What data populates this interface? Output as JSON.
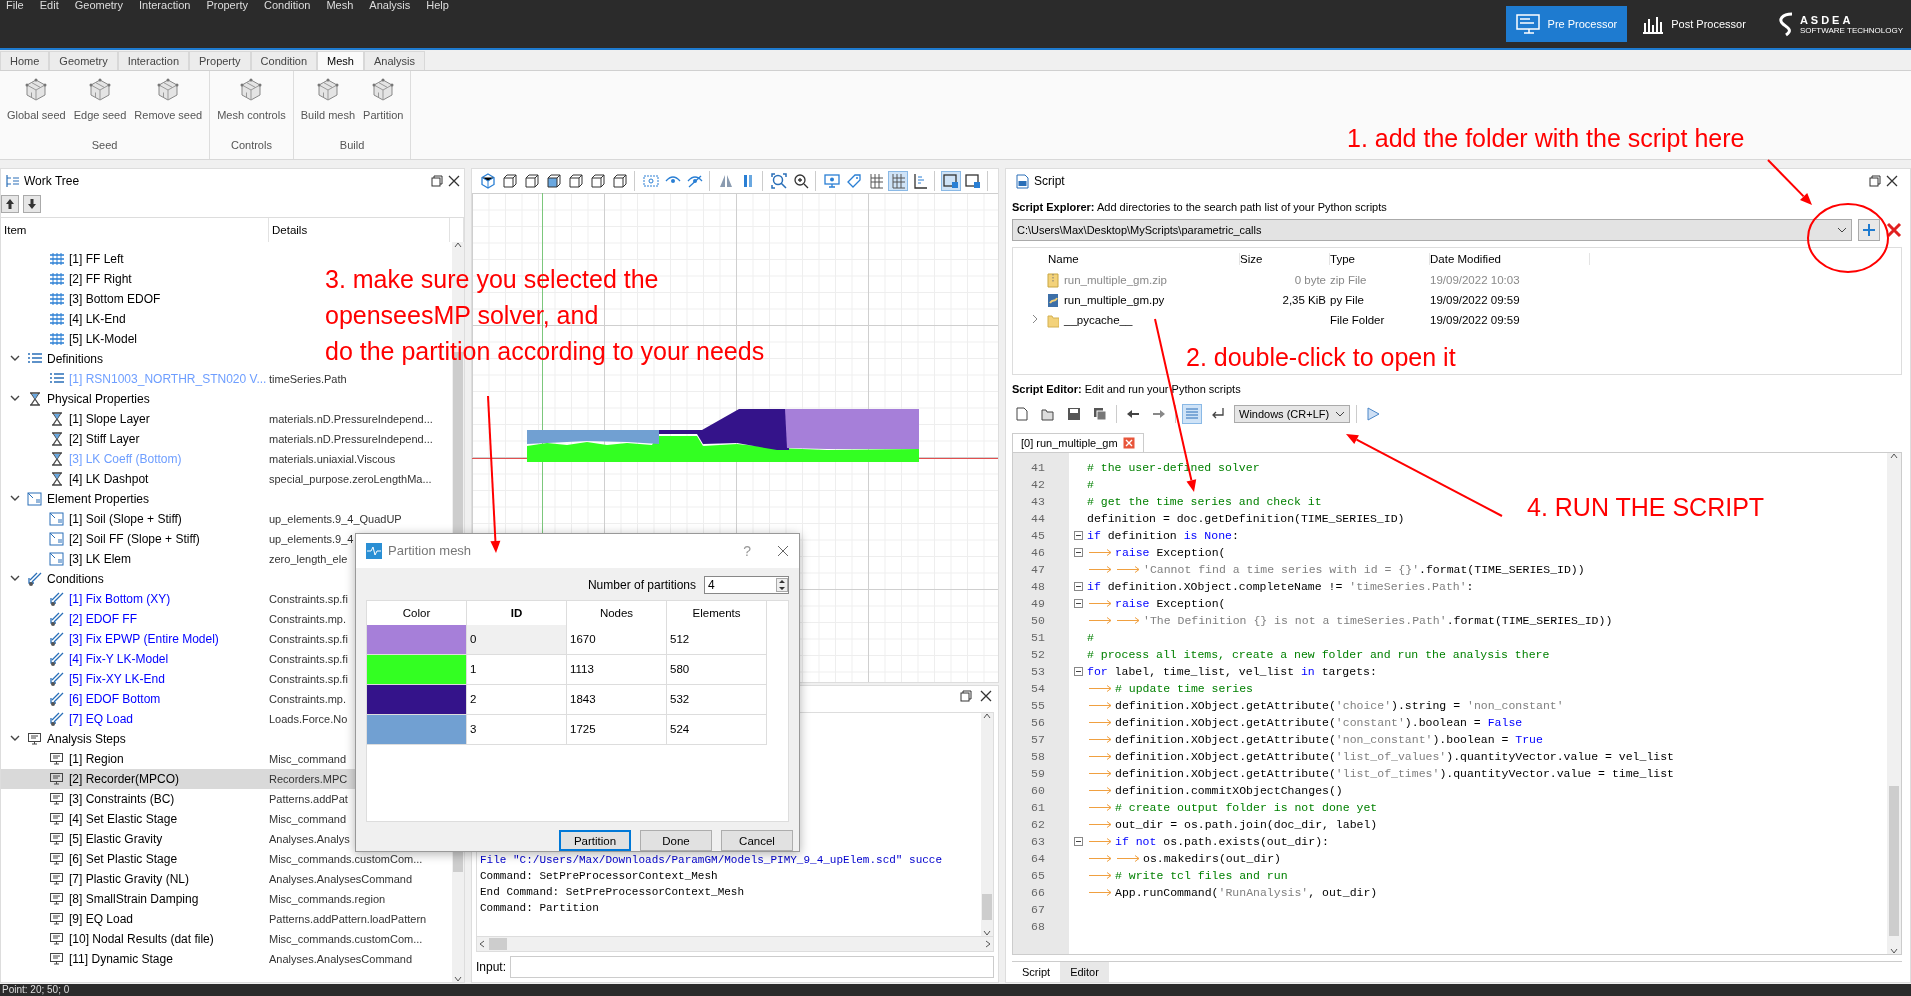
{
  "menu": [
    "File",
    "Edit",
    "Geometry",
    "Interaction",
    "Property",
    "Condition",
    "Mesh",
    "Analysis",
    "Help"
  ],
  "modes": [
    {
      "label": "Pre Processor",
      "selected": true
    },
    {
      "label": "Post Processor",
      "selected": false
    }
  ],
  "logo": {
    "name": "ASDEA",
    "tagline": "SOFTWARE TECHNOLOGY"
  },
  "ribbon_tabs": [
    {
      "label": "Home",
      "selected": false
    },
    {
      "label": "Geometry",
      "selected": false
    },
    {
      "label": "Interaction",
      "selected": false
    },
    {
      "label": "Property",
      "selected": false
    },
    {
      "label": "Condition",
      "selected": false
    },
    {
      "label": "Mesh",
      "selected": true
    },
    {
      "label": "Analysis",
      "selected": false
    }
  ],
  "ribbon_groups": [
    {
      "label": "Seed",
      "buttons": [
        "Global seed",
        "Edge seed",
        "Remove seed"
      ]
    },
    {
      "label": "Controls",
      "buttons": [
        "Mesh controls"
      ]
    },
    {
      "label": "Build",
      "buttons": [
        "Build mesh",
        "Partition"
      ]
    }
  ],
  "work_tree": {
    "title": "Work Tree",
    "columns": [
      "Item",
      "Details"
    ],
    "items": [
      {
        "children": [
          {
            "label": "[1] FF Left",
            "kind": "rails",
            "color": "#000000",
            "selected": false
          },
          {
            "label": "[2] FF Right",
            "kind": "rails",
            "color": "#000000",
            "selected": false
          },
          {
            "label": "[3] Bottom EDOF",
            "kind": "rails",
            "color": "#000000",
            "selected": false
          },
          {
            "label": "[4] LK-End",
            "kind": "rails",
            "color": "#000000",
            "selected": false
          },
          {
            "label": "[5] LK-Model",
            "kind": "rails",
            "color": "#000000",
            "selected": false
          }
        ]
      },
      {
        "label": "Definitions",
        "kind": "list",
        "expanded": true,
        "selected": false,
        "children": [
          {
            "label": "[1] RSN1003_NORTHR_STN020 V...",
            "details": "timeSeries.Path",
            "kind": "list",
            "color": "#6e9eff",
            "selected": false
          }
        ]
      },
      {
        "label": "Physical Properties",
        "kind": "hourglass",
        "expanded": true,
        "selected": false,
        "children": [
          {
            "label": "[1] Slope Layer",
            "details": "materials.nD.PressureIndepend...",
            "kind": "hourglass",
            "color": "#000000",
            "selected": false
          },
          {
            "label": "[2] Stiff Layer",
            "details": "materials.nD.PressureIndepend...",
            "kind": "hourglass",
            "color": "#000000",
            "selected": false
          },
          {
            "label": "[3] LK Coeff (Bottom)",
            "details": "materials.uniaxial.Viscous",
            "kind": "hourglass",
            "color": "#6e9eff",
            "selected": false
          },
          {
            "label": "[4] LK Dashpot",
            "details": "special_purpose.zeroLengthMa...",
            "kind": "hourglass",
            "color": "#000000",
            "selected": false
          }
        ]
      },
      {
        "label": "Element Properties",
        "kind": "element",
        "expanded": true,
        "selected": false,
        "children": [
          {
            "label": "[1] Soil (Slope + Stiff)",
            "details": "up_elements.9_4_QuadUP",
            "kind": "element",
            "color": "#000000",
            "selected": false
          },
          {
            "label": "[2] Soil FF (Slope + Stiff)",
            "details": "up_elements.9_4",
            "kind": "element",
            "color": "#000000",
            "selected": false
          },
          {
            "label": "[3] LK Elem",
            "details": "zero_length_ele",
            "kind": "element",
            "color": "#000000",
            "selected": false
          }
        ]
      },
      {
        "label": "Conditions",
        "kind": "arrows",
        "expanded": true,
        "selected": false,
        "children": [
          {
            "label": "[1] Fix Bottom (XY)",
            "details": "Constraints.sp.fi",
            "kind": "arrows",
            "color": "#0000ff",
            "selected": false
          },
          {
            "label": "[2] EDOF FF",
            "details": "Constraints.mp.",
            "kind": "arrows",
            "color": "#0000ff",
            "selected": false
          },
          {
            "label": "[3] Fix EPWP (Entire Model)",
            "details": "Constraints.sp.fi",
            "kind": "arrows",
            "color": "#0000ff",
            "selected": false
          },
          {
            "label": "[4] Fix-Y LK-Model",
            "details": "Constraints.sp.fi",
            "kind": "arrows",
            "color": "#0000ff",
            "selected": false
          },
          {
            "label": "[5] Fix-XY LK-End",
            "details": "Constraints.sp.fi",
            "kind": "arrows",
            "color": "#0000ff",
            "selected": false
          },
          {
            "label": "[6] EDOF Bottom",
            "details": "Constraints.mp.",
            "kind": "arrows",
            "color": "#0000ff",
            "selected": false
          },
          {
            "label": "[7] EQ Load",
            "details": "Loads.Force.No",
            "kind": "arrows",
            "color": "#0000ff",
            "selected": false
          }
        ]
      },
      {
        "label": "Analysis Steps",
        "kind": "monitor",
        "expanded": true,
        "selected": false,
        "children": [
          {
            "label": "[1] Region",
            "details": "Misc_command",
            "kind": "monitor",
            "color": "#000000",
            "selected": false
          },
          {
            "label": "[2] Recorder(MPCO)",
            "details": "Recorders.MPC",
            "kind": "monitor",
            "color": "#000000",
            "selected": true
          },
          {
            "label": "[3] Constraints (BC)",
            "details": "Patterns.addPat",
            "kind": "monitor",
            "color": "#000000",
            "selected": false
          },
          {
            "label": "[4] Set Elastic Stage",
            "details": "Misc_command",
            "kind": "monitor",
            "color": "#000000",
            "selected": false
          },
          {
            "label": "[5] Elastic Gravity",
            "details": "Analyses.Analys",
            "kind": "monitor",
            "color": "#000000",
            "selected": false
          },
          {
            "label": "[6] Set Plastic Stage",
            "details": "Misc_commands.customCom...",
            "kind": "monitor",
            "color": "#000000",
            "selected": false
          },
          {
            "label": "[7] Plastic Gravity (NL)",
            "details": "Analyses.AnalysesCommand",
            "kind": "monitor",
            "color": "#000000",
            "selected": false
          },
          {
            "label": "[8] SmallStrain Damping",
            "details": "Misc_commands.region",
            "kind": "monitor",
            "color": "#000000",
            "selected": false
          },
          {
            "label": "[9] EQ Load",
            "details": "Patterns.addPattern.loadPattern",
            "kind": "monitor",
            "color": "#000000",
            "selected": false
          },
          {
            "label": "[10] Nodal Results (dat file)",
            "details": "Misc_commands.customCom...",
            "kind": "monitor",
            "color": "#000000",
            "selected": false
          },
          {
            "label": "[11] Dynamic Stage",
            "details": "Analyses.AnalysesCommand",
            "kind": "monitor",
            "color": "#000000",
            "selected": false
          }
        ]
      }
    ]
  },
  "viewport_toolbar": [
    [
      {
        "kind": "iso",
        "selected": false
      },
      {
        "kind": "cube",
        "selected": false
      },
      {
        "kind": "cube",
        "selected": false
      },
      {
        "kind": "cube-filled",
        "selected": false
      },
      {
        "kind": "cube",
        "selected": false
      },
      {
        "kind": "cube",
        "selected": false
      },
      {
        "kind": "cube",
        "selected": false
      }
    ],
    [
      {
        "kind": "select",
        "selected": false
      },
      {
        "kind": "eye",
        "selected": false
      },
      {
        "kind": "eye-off",
        "selected": false
      }
    ],
    [
      {
        "kind": "mirror",
        "selected": false
      },
      {
        "kind": "bars",
        "selected": false
      }
    ],
    [
      {
        "kind": "zoom-fit",
        "selected": false
      },
      {
        "kind": "zoom",
        "selected": false
      }
    ],
    [
      {
        "kind": "monitor",
        "selected": false
      },
      {
        "kind": "tag",
        "selected": false
      },
      {
        "kind": "grid",
        "selected": false
      },
      {
        "kind": "grid",
        "selected": true
      },
      {
        "kind": "axes",
        "selected": false
      }
    ],
    [
      {
        "kind": "box",
        "selected": true
      },
      {
        "kind": "box",
        "selected": false
      }
    ]
  ],
  "console": {
    "lines": [
      {
        "kind": "info",
        "text": "File \"C:/Users/Max/Downloads/ParamGM/Models_PIMY_9_4_upElem.scd\" succe"
      },
      {
        "kind": "plain",
        "text": "Command: SetPreProcessorContext_Mesh"
      },
      {
        "kind": "plain",
        "text": "End Command: SetPreProcessorContext_Mesh"
      },
      {
        "kind": "plain",
        "text": "Command: Partition"
      }
    ],
    "input_label": "Input:"
  },
  "dialog": {
    "title": "Partition mesh",
    "help": "?",
    "count_label": "Number of partitions",
    "count": "4",
    "columns": [
      "Color",
      "ID",
      "Nodes",
      "Elements"
    ],
    "rows": [
      {
        "color": "#a67fd9",
        "id": "0",
        "nodes": "1670",
        "elements": "512",
        "selected": true
      },
      {
        "color": "#33ff22",
        "id": "1",
        "nodes": "1113",
        "elements": "580",
        "selected": false
      },
      {
        "color": "#34138a",
        "id": "2",
        "nodes": "1843",
        "elements": "532",
        "selected": false
      },
      {
        "color": "#71a0d2",
        "id": "3",
        "nodes": "1725",
        "elements": "524",
        "selected": false
      }
    ],
    "buttons": [
      {
        "label": "Partition",
        "default": true
      },
      {
        "label": "Done",
        "default": false
      },
      {
        "label": "Cancel",
        "default": false
      }
    ]
  },
  "script": {
    "title": "Script",
    "explorer_hint": "**Script Explorer:** Add directories to the search path list of your Python scripts",
    "path": "C:\\Users\\Max\\Desktop\\MyScripts\\parametric_calls",
    "columns": [
      "Name",
      "Size",
      "Type",
      "Date Modified"
    ],
    "files": [
      {
        "kind": "zip",
        "dimmed": true,
        "name": "run_multiple_gm.zip",
        "size": "0 byte",
        "type": "zip File",
        "date": "19/09/2022 10:03"
      },
      {
        "kind": "py",
        "dimmed": false,
        "name": "run_multiple_gm.py",
        "size": "2,35 KiB",
        "type": "py File",
        "date": "19/09/2022 09:59"
      },
      {
        "kind": "folder",
        "dimmed": false,
        "name": "__pycache__",
        "type": "File Folder",
        "date": "19/09/2022 09:59"
      }
    ],
    "editor_hint": "**Script Editor:** Edit and run your Python scripts",
    "wrap_on": true,
    "line_ending": "Windows (CR+LF)",
    "tabs": [
      {
        "label": "[0] run_multiple_gm",
        "selected": true
      }
    ],
    "code": [
      {
        "num": "41",
        "fold": false,
        "parts": [
          {
            "kind": "comment",
            "text": "# the user-defined solver"
          }
        ]
      },
      {
        "num": "42",
        "fold": false,
        "parts": [
          {
            "kind": "comment",
            "text": "#"
          }
        ]
      },
      {
        "num": "43",
        "fold": false,
        "parts": [
          {
            "kind": "comment",
            "text": "# get the time series and check it"
          }
        ]
      },
      {
        "num": "44",
        "fold": false,
        "parts": [
          {
            "kind": "plain",
            "text": "definition = doc.getDefinition(TIME_SERIES_ID)"
          }
        ]
      },
      {
        "num": "45",
        "fold": true,
        "parts": [
          {
            "kind": "keyword",
            "text": "if"
          },
          {
            "kind": "plain",
            "text": " definition "
          },
          {
            "kind": "keyword",
            "text": "is None"
          },
          {
            "kind": "plain",
            "text": ":"
          }
        ]
      },
      {
        "num": "46",
        "fold": true,
        "parts": [
          {
            "kind": "tab"
          },
          {
            "kind": "keyword",
            "text": "raise"
          },
          {
            "kind": "plain",
            "text": " Exception("
          }
        ]
      },
      {
        "num": "47",
        "fold": false,
        "parts": [
          {
            "kind": "tab"
          },
          {
            "kind": "tab"
          },
          {
            "kind": "string",
            "text": "'Cannot find a time series with id = {}'"
          },
          {
            "kind": "plain",
            "text": ".format(TIME_SERIES_ID))"
          }
        ]
      },
      {
        "num": "48",
        "fold": true,
        "parts": [
          {
            "kind": "keyword",
            "text": "if"
          },
          {
            "kind": "plain",
            "text": " definition.XObject.completeName != "
          },
          {
            "kind": "string",
            "text": "'timeSeries.Path'"
          },
          {
            "kind": "plain",
            "text": ":"
          }
        ]
      },
      {
        "num": "49",
        "fold": true,
        "parts": [
          {
            "kind": "tab"
          },
          {
            "kind": "keyword",
            "text": "raise"
          },
          {
            "kind": "plain",
            "text": " Exception("
          }
        ]
      },
      {
        "num": "50",
        "fold": false,
        "parts": [
          {
            "kind": "tab"
          },
          {
            "kind": "tab"
          },
          {
            "kind": "string",
            "text": "'The Definition {} is not a timeSeries.Path'"
          },
          {
            "kind": "plain",
            "text": ".format(TIME_SERIES_ID))"
          }
        ]
      },
      {
        "num": "51",
        "fold": false,
        "parts": [
          {
            "kind": "comment",
            "text": "#"
          }
        ]
      },
      {
        "num": "52",
        "fold": false,
        "parts": [
          {
            "kind": "comment",
            "text": "# process all items, create a new folder and run the analysis there"
          }
        ]
      },
      {
        "num": "53",
        "fold": true,
        "parts": [
          {
            "kind": "keyword",
            "text": "for"
          },
          {
            "kind": "plain",
            "text": " label, time_list, vel_list "
          },
          {
            "kind": "keyword",
            "text": "in"
          },
          {
            "kind": "plain",
            "text": " targets:"
          }
        ]
      },
      {
        "num": "54",
        "fold": false,
        "parts": [
          {
            "kind": "tab"
          },
          {
            "kind": "comment",
            "text": "# update time series"
          }
        ]
      },
      {
        "num": "55",
        "fold": false,
        "parts": [
          {
            "kind": "tab"
          },
          {
            "kind": "plain",
            "text": "definition.XObject.getAttribute("
          },
          {
            "kind": "string",
            "text": "'choice'"
          },
          {
            "kind": "plain",
            "text": ").string = "
          },
          {
            "kind": "string",
            "text": "'non_constant'"
          }
        ]
      },
      {
        "num": "56",
        "fold": false,
        "parts": [
          {
            "kind": "tab"
          },
          {
            "kind": "plain",
            "text": "definition.XObject.getAttribute("
          },
          {
            "kind": "string",
            "text": "'constant'"
          },
          {
            "kind": "plain",
            "text": ").boolean = "
          },
          {
            "kind": "keyword",
            "text": "False"
          }
        ]
      },
      {
        "num": "57",
        "fold": false,
        "parts": [
          {
            "kind": "tab"
          },
          {
            "kind": "plain",
            "text": "definition.XObject.getAttribute("
          },
          {
            "kind": "string",
            "text": "'non_constant'"
          },
          {
            "kind": "plain",
            "text": ").boolean = "
          },
          {
            "kind": "keyword",
            "text": "True"
          }
        ]
      },
      {
        "num": "58",
        "fold": false,
        "parts": [
          {
            "kind": "tab"
          },
          {
            "kind": "plain",
            "text": "definition.XObject.getAttribute("
          },
          {
            "kind": "string",
            "text": "'list_of_values'"
          },
          {
            "kind": "plain",
            "text": ").quantityVector.value = vel_list"
          }
        ]
      },
      {
        "num": "59",
        "fold": false,
        "parts": [
          {
            "kind": "tab"
          },
          {
            "kind": "plain",
            "text": "definition.XObject.getAttribute("
          },
          {
            "kind": "string",
            "text": "'list_of_times'"
          },
          {
            "kind": "plain",
            "text": ").quantityVector.value = time_list"
          }
        ]
      },
      {
        "num": "60",
        "fold": false,
        "parts": [
          {
            "kind": "tab"
          },
          {
            "kind": "plain",
            "text": "definition.commitXObjectChanges()"
          }
        ]
      },
      {
        "num": "61",
        "fold": false,
        "parts": [
          {
            "kind": "tab"
          },
          {
            "kind": "comment",
            "text": "# create output folder is not done yet"
          }
        ]
      },
      {
        "num": "62",
        "fold": false,
        "parts": [
          {
            "kind": "tab"
          },
          {
            "kind": "plain",
            "text": "out_dir = os.path.join(doc_dir, label)"
          }
        ]
      },
      {
        "num": "63",
        "fold": true,
        "parts": [
          {
            "kind": "tab"
          },
          {
            "kind": "keyword",
            "text": "if not"
          },
          {
            "kind": "plain",
            "text": " os.path.exists(out_dir):"
          }
        ]
      },
      {
        "num": "64",
        "fold": false,
        "parts": [
          {
            "kind": "tab"
          },
          {
            "kind": "tab"
          },
          {
            "kind": "plain",
            "text": "os.makedirs(out_dir)"
          }
        ]
      },
      {
        "num": "65",
        "fold": false,
        "parts": [
          {
            "kind": "tab"
          },
          {
            "kind": "comment",
            "text": "# write tcl files and run"
          }
        ]
      },
      {
        "num": "66",
        "fold": false,
        "parts": [
          {
            "kind": "tab"
          },
          {
            "kind": "plain",
            "text": "App.runCommand("
          },
          {
            "kind": "string",
            "text": "'RunAnalysis'"
          },
          {
            "kind": "plain",
            "text": ", out_dir)"
          }
        ]
      },
      {
        "num": "67",
        "fold": false
      },
      {
        "num": "68",
        "fold": false
      }
    ],
    "bottom_tabs": [
      {
        "label": "Script",
        "selected": true
      },
      {
        "label": "Editor",
        "selected": false
      }
    ]
  },
  "annotations": [
    [
      "1. add the folder with the script here"
    ],
    [
      "3. make sure you selected the",
      "openseesMP solver, and",
      "do the partition according to your needs"
    ],
    [
      "2. double-click to open it"
    ],
    [
      "4. RUN THE SCRIPT"
    ]
  ],
  "status_bar": "Point: 20;  50; 0"
}
